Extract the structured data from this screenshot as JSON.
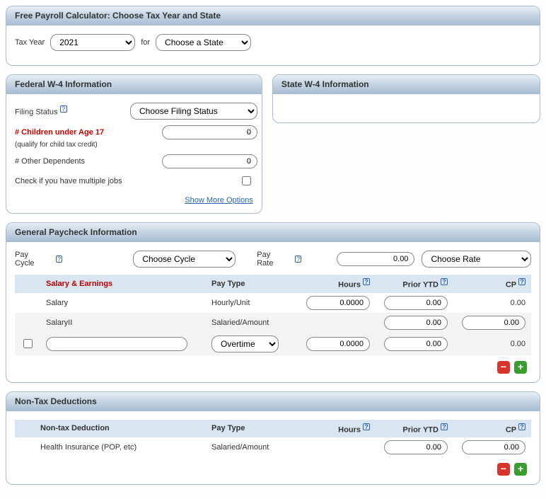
{
  "topPanel": {
    "title": "Free Payroll Calculator: Choose Tax Year and State",
    "taxYearLabel": "Tax Year",
    "taxYearValue": "2021",
    "forLabel": "for",
    "stateValue": "Choose a State"
  },
  "federal": {
    "title": "Federal W-4 Information",
    "filingStatusLabel": "Filing Status",
    "filingStatusValue": "Choose Filing Status",
    "childrenLabel": "# Children under Age 17",
    "childrenNote": "(qualify for child tax credit)",
    "childrenValue": "0",
    "otherDepLabel": "# Other Dependents",
    "otherDepValue": "0",
    "multiJobsLabel": "Check if you have multiple jobs",
    "showMore": "Show More Options"
  },
  "state": {
    "title": "State W-4 Information"
  },
  "general": {
    "title": "General Paycheck Information",
    "payCycleLabel": "Pay Cycle",
    "payCycleValue": "Choose Cycle",
    "payRateLabel": "Pay Rate",
    "payRateValue": "0.00",
    "rateUnitValue": "Choose Rate",
    "cols": {
      "salary": "Salary & Earnings",
      "payType": "Pay Type",
      "hours": "Hours",
      "priorYtd": "Prior YTD",
      "cp": "CP"
    },
    "rows": [
      {
        "name": "Salary",
        "payType": "Hourly/Unit",
        "hours": "0.0000",
        "priorYtd": "0.00",
        "cp": "0.00"
      },
      {
        "name": "SalaryII",
        "payType": "Salaried/Amount",
        "hours": "",
        "priorYtd": "0.00",
        "cp": "0.00"
      }
    ],
    "customRow": {
      "name": "",
      "payType": "Overtime",
      "hours": "0.0000",
      "priorYtd": "0.00",
      "cp": "0.00"
    }
  },
  "nontax": {
    "title": "Non-Tax Deductions",
    "cols": {
      "name": "Non-tax Deduction",
      "payType": "Pay Type",
      "hours": "Hours",
      "priorYtd": "Prior YTD",
      "cp": "CP"
    },
    "rows": [
      {
        "name": "Health Insurance (POP, etc)",
        "payType": "Salaried/Amount",
        "hours": "",
        "priorYtd": "0.00",
        "cp": "0.00"
      }
    ]
  }
}
